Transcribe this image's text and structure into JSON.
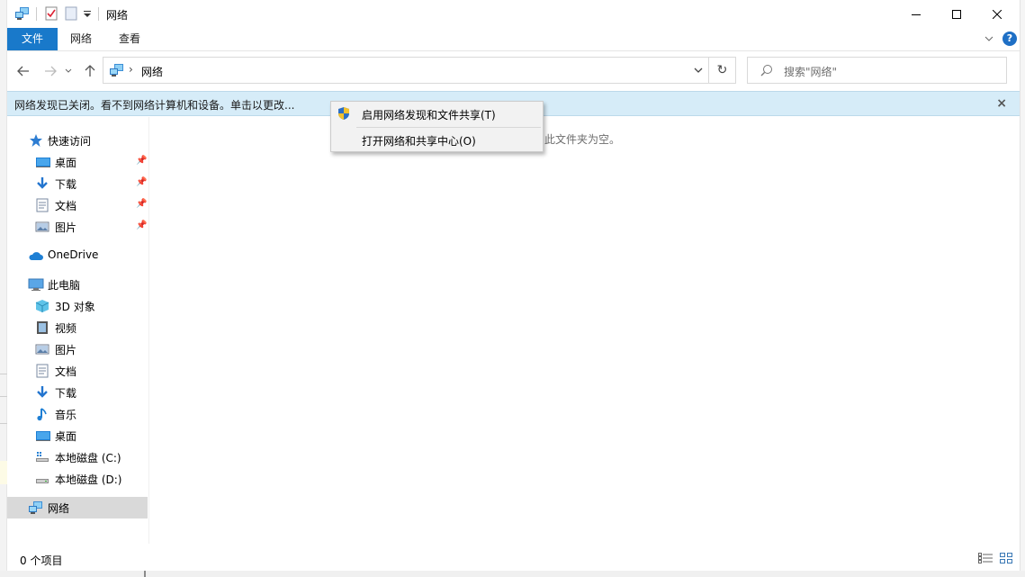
{
  "window": {
    "title": "网络",
    "minimize_icon": "minimize-icon",
    "maximize_icon": "maximize-icon",
    "close_icon": "close-icon"
  },
  "ribbon": {
    "tabs": [
      {
        "label": "文件",
        "active": true
      },
      {
        "label": "网络"
      },
      {
        "label": "查看"
      }
    ],
    "help_label": "?"
  },
  "address": {
    "path": "网络",
    "search_placeholder": "搜索\"网络\""
  },
  "infobar": {
    "text": "网络发现已关闭。看不到网络计算机和设备。单击以更改...",
    "close": "×"
  },
  "context_menu": {
    "items": [
      {
        "label": "启用网络发现和文件共享(T)",
        "icon": "shield-icon"
      },
      {
        "label": "打开网络和共享中心(O)"
      }
    ]
  },
  "nav": {
    "quick_access": "快速访问",
    "quick_items": [
      {
        "label": "桌面",
        "icon": "desktop-icon",
        "pinned": true
      },
      {
        "label": "下载",
        "icon": "download-icon",
        "pinned": true
      },
      {
        "label": "文档",
        "icon": "document-icon",
        "pinned": true
      },
      {
        "label": "图片",
        "icon": "picture-icon",
        "pinned": true
      }
    ],
    "onedrive": "OneDrive",
    "this_pc": "此电脑",
    "pc_items": [
      {
        "label": "3D 对象",
        "icon": "3d-objects-icon"
      },
      {
        "label": "视频",
        "icon": "video-icon"
      },
      {
        "label": "图片",
        "icon": "picture-icon"
      },
      {
        "label": "文档",
        "icon": "document-icon"
      },
      {
        "label": "下载",
        "icon": "download-icon"
      },
      {
        "label": "音乐",
        "icon": "music-icon"
      },
      {
        "label": "桌面",
        "icon": "desktop-icon"
      },
      {
        "label": "本地磁盘 (C:)",
        "icon": "drive-c-icon"
      },
      {
        "label": "本地磁盘 (D:)",
        "icon": "drive-icon"
      }
    ],
    "network": "网络"
  },
  "content": {
    "empty_text": "此文件夹为空。"
  },
  "status": {
    "item_count": "0 个项目"
  },
  "colors": {
    "accent": "#1979ca",
    "infobar": "#d6ecf8",
    "selected": "#d9d9d9"
  }
}
